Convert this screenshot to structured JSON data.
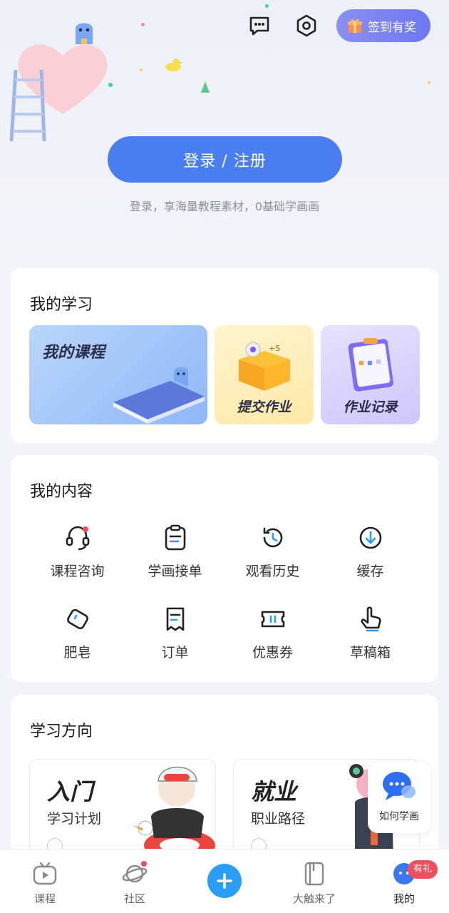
{
  "header": {
    "checkin_label": "签到有奖",
    "icons": [
      "message-icon",
      "settings-icon",
      "gift-icon"
    ]
  },
  "login": {
    "button_label": "登录 / 注册",
    "tip": "登录，享海量教程素材，0基础学画画"
  },
  "study": {
    "title": "我的学习",
    "tiles": [
      {
        "label": "我的课程"
      },
      {
        "label": "提交作业"
      },
      {
        "label": "作业记录"
      }
    ]
  },
  "content": {
    "title": "我的内容",
    "items": [
      {
        "label": "课程咨询",
        "icon": "headset-icon"
      },
      {
        "label": "学画接单",
        "icon": "clipboard-icon"
      },
      {
        "label": "观看历史",
        "icon": "history-icon"
      },
      {
        "label": "缓存",
        "icon": "download-icon"
      },
      {
        "label": "肥皂",
        "icon": "soap-icon"
      },
      {
        "label": "订单",
        "icon": "order-icon"
      },
      {
        "label": "优惠券",
        "icon": "coupon-icon"
      },
      {
        "label": "草稿箱",
        "icon": "draft-hand-icon"
      }
    ]
  },
  "direction": {
    "title": "学习方向",
    "tiles": [
      {
        "big": "入门",
        "sub": "学习计划"
      },
      {
        "big": "就业",
        "sub": "职业路径"
      }
    ]
  },
  "float_help": {
    "label": "如何学画"
  },
  "tabbar": {
    "tabs": [
      {
        "label": "课程",
        "icon": "tv-icon"
      },
      {
        "label": "社区",
        "icon": "planet-icon"
      },
      {
        "label": "大触来了",
        "icon": "book-icon"
      },
      {
        "label": "我的",
        "icon": "profile-icon"
      }
    ],
    "gift_badge": "有礼"
  },
  "colors": {
    "primary": "#4a7ef0",
    "checkin": "#7b82f2",
    "badge": "#f24d5c",
    "add": "#2a9df4"
  }
}
